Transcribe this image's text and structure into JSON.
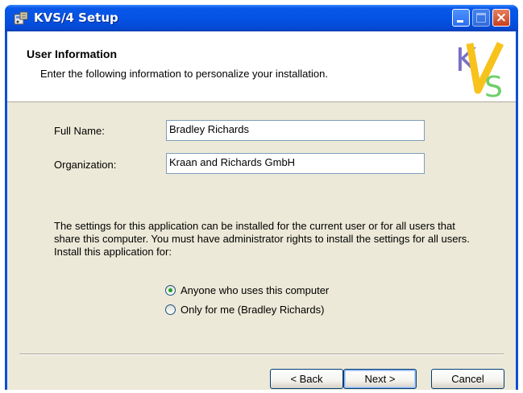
{
  "window": {
    "title": "KVS/4 Setup",
    "controls": {
      "minimize": "minimize",
      "maximize": "maximize",
      "close": "×"
    }
  },
  "banner": {
    "title": "User Information",
    "subtitle": "Enter the following information to personalize your installation.",
    "logo_letters": [
      "K",
      "V",
      "S"
    ]
  },
  "form": {
    "full_name": {
      "label": "Full Name:",
      "value": "Bradley Richards"
    },
    "organization": {
      "label": "Organization:",
      "value": "Kraan and Richards GmbH"
    }
  },
  "install_for": {
    "description": "The settings for this application can be installed for the current user or for all users that share this computer. You must have administrator rights to install the settings for all users. Install this application for:",
    "options": [
      {
        "label": "Anyone who uses this computer",
        "selected": true
      },
      {
        "label": "Only for me (Bradley Richards)",
        "selected": false
      }
    ]
  },
  "buttons": {
    "back": "< Back",
    "next": "Next >",
    "cancel": "Cancel"
  },
  "colors": {
    "titlebar": "#0553e4",
    "dialog_bg": "#ece9d8",
    "logo_k": "#7a6fc7",
    "logo_v": "#f7c21b",
    "logo_s": "#6fcf6a"
  }
}
